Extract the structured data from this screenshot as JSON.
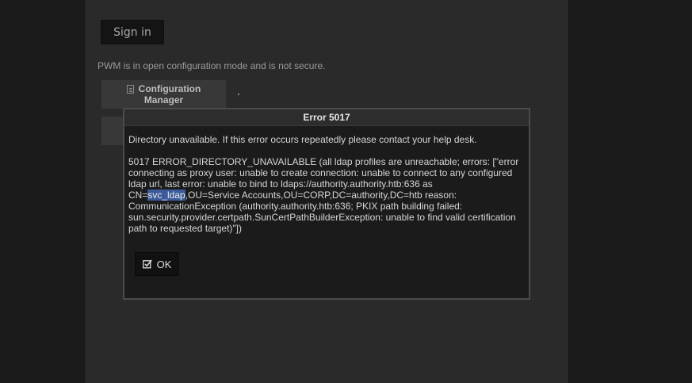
{
  "login": {
    "signin_label": "Sign in",
    "notice": "PWM is in open configuration mode and is not secure.",
    "config_manager_label_line1": "Configuration",
    "config_manager_label_line2": "Manager"
  },
  "dialog": {
    "title": "Error 5017",
    "message": "Directory unavailable. If this error occurs repeatedly please contact your help desk.",
    "detail_before": "5017 ERROR_DIRECTORY_UNAVAILABLE (all ldap profiles are unreachable; errors: [\"error connecting as proxy user: unable to create connection: unable to connect to any configured ldap url, last error: unable to bind to ldaps://authority.authority.htb:636 as CN=",
    "detail_highlight": "svc_ldap",
    "detail_after": ",OU=Service Accounts,OU=CORP,DC=authority,DC=htb reason: CommunicationException (authority.authority.htb:636; PKIX path building failed: sun.security.provider.certpath.SunCertPathBuilderException: unable to find valid certification path to requested target)\"])",
    "ok_label": "OK"
  },
  "icons": {
    "config_tile": "document-icon",
    "ok_button": "check-square-icon"
  },
  "colors": {
    "selection_highlight": "#3b5b9a",
    "dialog_border": "#4b4b4b"
  }
}
